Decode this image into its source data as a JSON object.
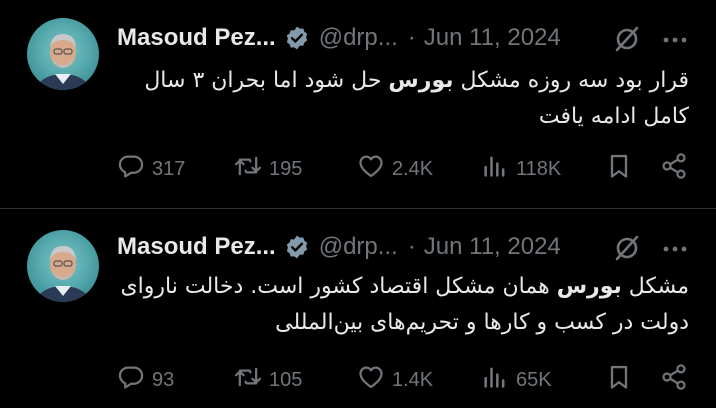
{
  "tweets": [
    {
      "author_name": "Masoud Pez...",
      "handle": "@drp...",
      "separator": "·",
      "date": "Jun 11, 2024",
      "text_before": "قرار بود سه روزه مشکل ",
      "text_bold": "بورس",
      "text_after": " حل شود اما بحران ۳ سال کامل ادامه یافت",
      "replies": "317",
      "reposts": "195",
      "likes": "2.4K",
      "views": "118K"
    },
    {
      "author_name": "Masoud Pez...",
      "handle": "@drp...",
      "separator": "·",
      "date": "Jun 11, 2024",
      "text_before": "مشکل ",
      "text_bold": "بورس",
      "text_after": " همان مشکل اقتصاد کشور است. دخالت ناروای دولت در کسب و کارها و تحریم‌های بین‌المللی",
      "replies": "93",
      "reposts": "105",
      "likes": "1.4K",
      "views": "65K"
    }
  ],
  "icons": {
    "verified": "verified-badge-icon",
    "grok": "grok-icon",
    "more": "more-icon",
    "reply": "reply-icon",
    "repost": "repost-icon",
    "like": "heart-icon",
    "views": "views-icon",
    "bookmark": "bookmark-icon",
    "share": "share-icon"
  },
  "colors": {
    "background": "#000000",
    "text": "#e7e9ea",
    "muted": "#71767b",
    "divider": "#2f3336",
    "verified_badge": "#829aab"
  }
}
